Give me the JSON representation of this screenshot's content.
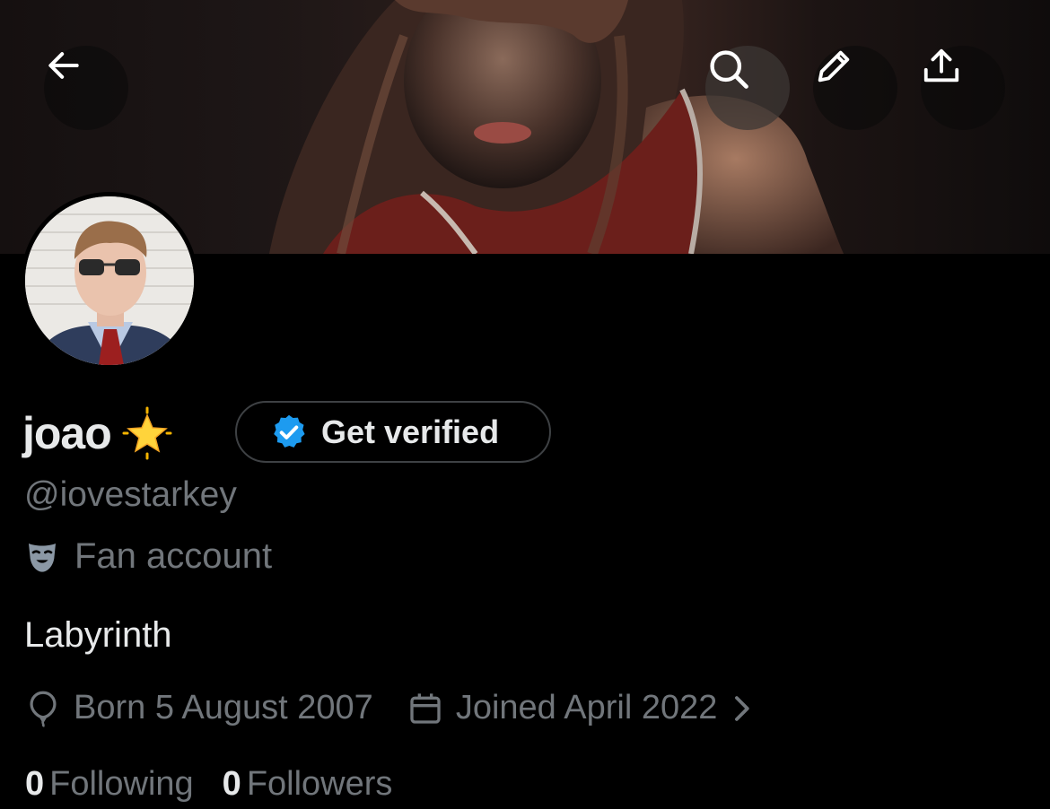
{
  "header": {
    "back_icon": "arrow-left-icon",
    "search_icon": "search-icon",
    "edit_icon": "pencil-icon",
    "share_icon": "share-upload-icon"
  },
  "profile": {
    "display_name": "joao",
    "name_emoji": "glowing-star",
    "verify_button": "Get verified",
    "handle": "@iovestarkey",
    "category": "Fan account",
    "category_icon": "theater-mask-icon",
    "bio": "Labyrinth",
    "born": "Born 5 August 2007",
    "born_icon": "balloon-icon",
    "joined": "Joined April 2022",
    "joined_icon": "calendar-icon",
    "following_count": "0",
    "following_label": "Following",
    "followers_count": "0",
    "followers_label": "Followers"
  },
  "colors": {
    "background": "#000000",
    "primary_text": "#e7e9ea",
    "secondary_text": "#71767b",
    "verified_blue": "#1d9bf0",
    "button_border": "#3e4144"
  }
}
